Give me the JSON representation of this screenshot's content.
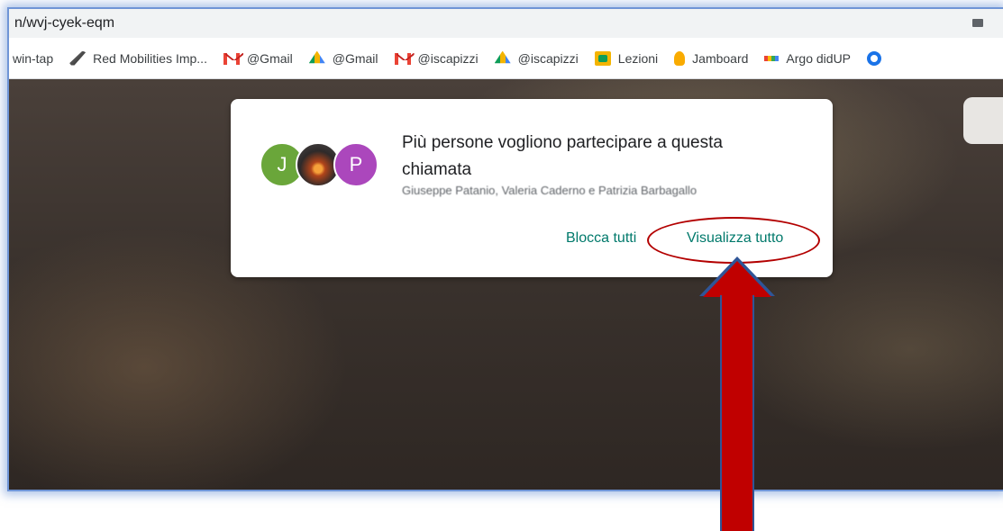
{
  "browser": {
    "url": "n/wvj-cyek-eqm",
    "bookmarks": [
      {
        "label": "win-tap",
        "icon": "none"
      },
      {
        "label": "Red Mobilities Imp...",
        "icon": "feather-icon"
      },
      {
        "label": "@Gmail",
        "icon": "gmail-icon"
      },
      {
        "label": "@Gmail",
        "icon": "drive-icon"
      },
      {
        "label": "@iscapizzi",
        "icon": "gmail-icon"
      },
      {
        "label": "@iscapizzi",
        "icon": "drive-icon"
      },
      {
        "label": "Lezioni",
        "icon": "classroom-icon"
      },
      {
        "label": "Jamboard",
        "icon": "jamboard-icon"
      },
      {
        "label": "Argo didUP",
        "icon": "argo-icon"
      }
    ]
  },
  "dialog": {
    "avatars": [
      "J",
      "",
      "P"
    ],
    "title": "Più persone vogliono partecipare a questa chiamata",
    "names": "Giuseppe Patanio, Valeria Caderno e Patrizia Barbagallo",
    "block_label": "Blocca tutti",
    "view_label": "Visualizza tutto"
  },
  "colors": {
    "accent_button": "#00796b",
    "annotation_arrow": "#c00000",
    "annotation_outline": "#2f5597"
  }
}
